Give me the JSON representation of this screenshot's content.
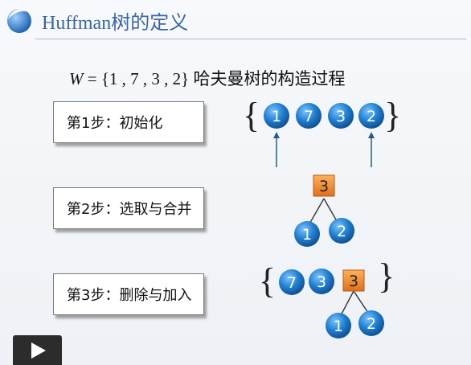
{
  "header": {
    "title": "Huffman树的定义",
    "logo": "blue-swoosh-logo-icon"
  },
  "formula": {
    "variable": "W",
    "set_text": "= {1 , 7 , 3 , 2}",
    "caption": "哈夫曼树的构造过程"
  },
  "steps": [
    {
      "label": "第1步：初始化"
    },
    {
      "label": "第2步：选取与合并"
    },
    {
      "label": "第3步：删除与加入"
    }
  ],
  "diagram": {
    "step1": {
      "open_brace": "{",
      "close_brace": "}",
      "nodes": [
        "1",
        "7",
        "3",
        "2"
      ]
    },
    "step2": {
      "parent": "3",
      "children": [
        "1",
        "2"
      ]
    },
    "step3": {
      "open_brace": "{",
      "close_brace": "}",
      "leaves": [
        "7",
        "3"
      ],
      "merged_parent": "3",
      "merged_children": [
        "1",
        "2"
      ]
    }
  },
  "colors": {
    "leaf_node": "#1f7fd0",
    "merged_node": "#f08a2c",
    "title": "#3a66a8",
    "arrow": "#2b5a8a"
  },
  "player": {
    "icon": "play-icon"
  }
}
